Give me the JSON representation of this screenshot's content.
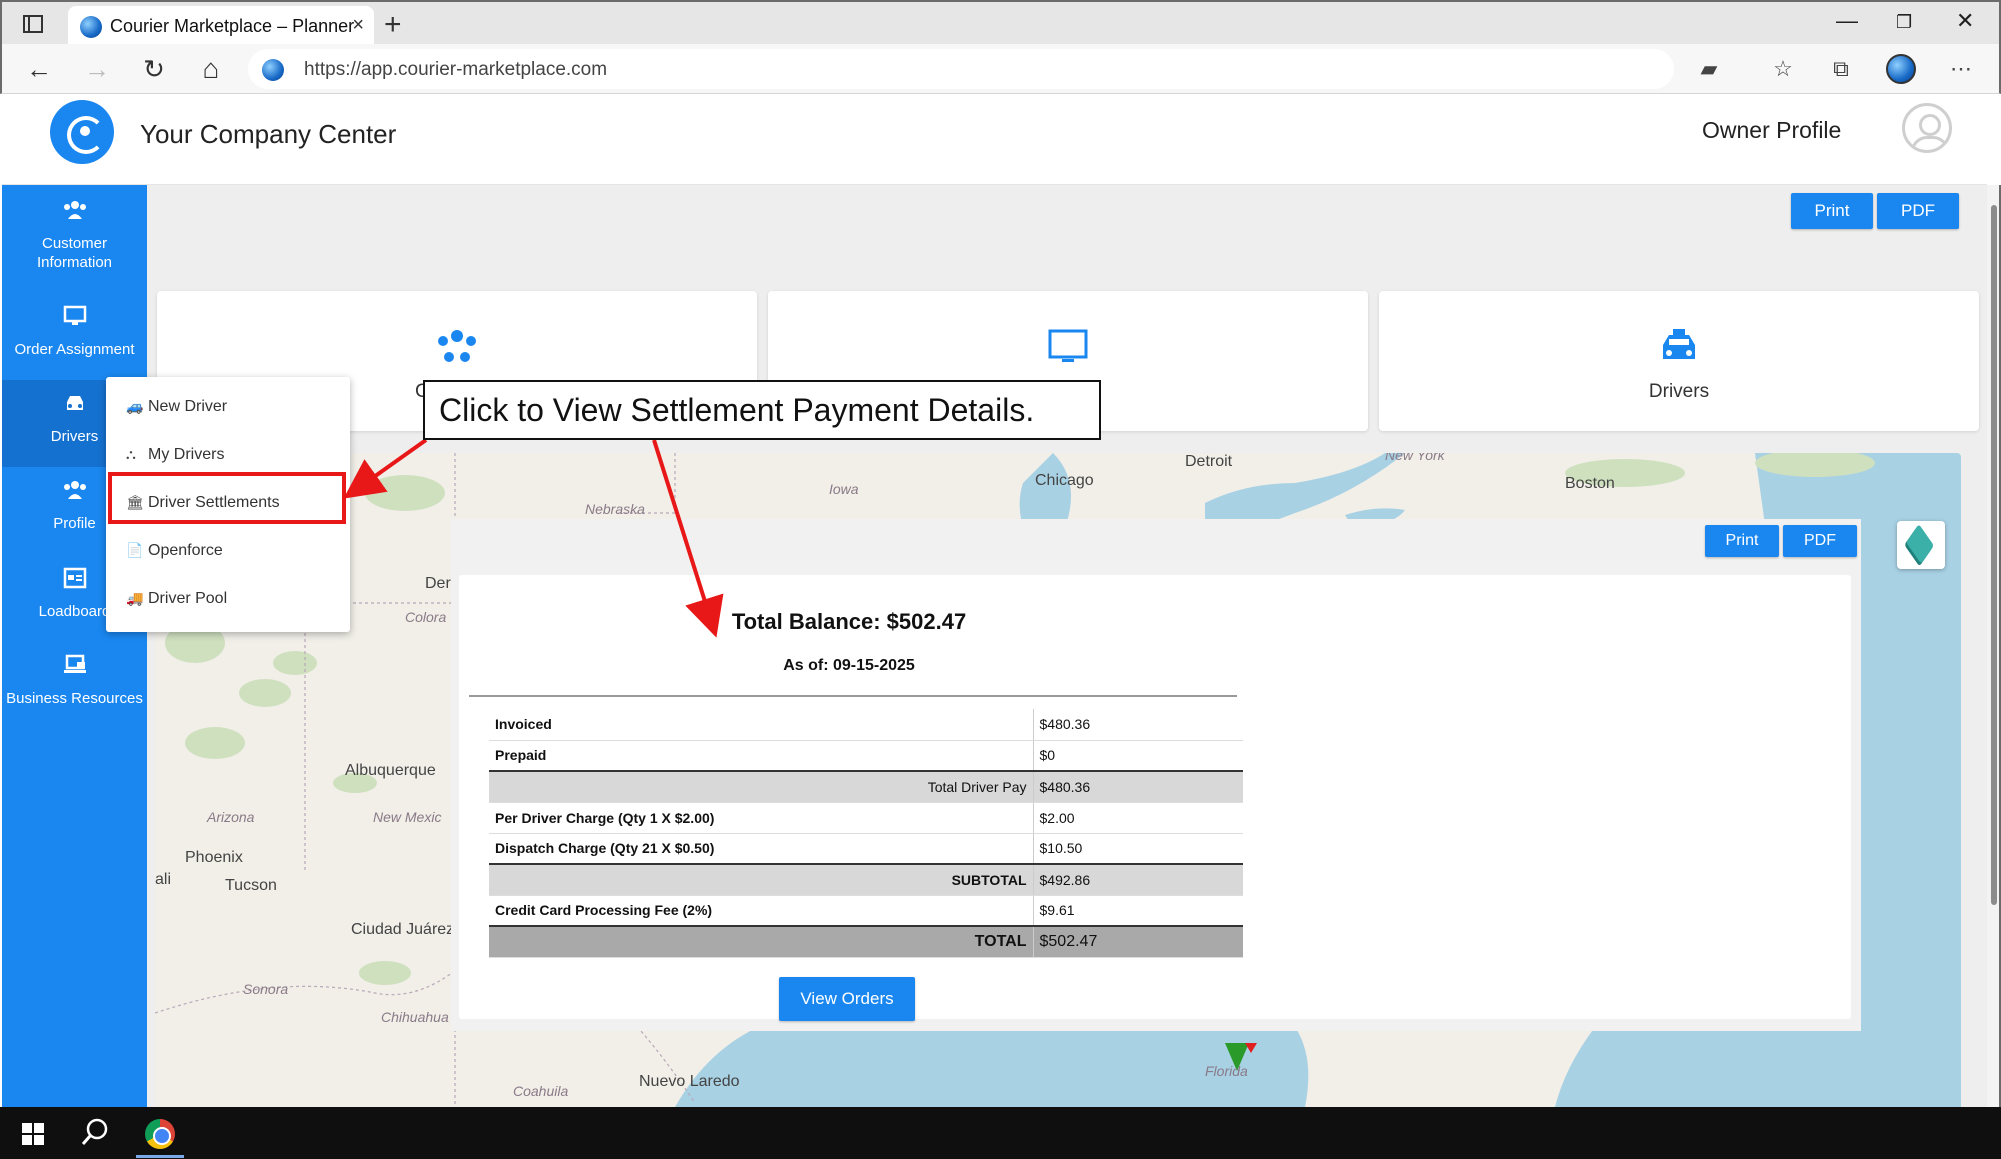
{
  "browser": {
    "tab_title": "Courier Marketplace – Planner",
    "tab_close": "×",
    "new_tab": "+",
    "url": "https://app.courier-marketplace.com",
    "window_controls": {
      "minimize": "—",
      "restore": "❐",
      "close": "✕"
    },
    "nav": {
      "back": "←",
      "forward": "→",
      "reload": "↻",
      "home": "⌂"
    },
    "toolbar_icons": [
      "extension-icon",
      "favorites-icon",
      "collections-icon",
      "profile-icon",
      "more-icon"
    ]
  },
  "header": {
    "title": "Your Company Center",
    "owner_profile": "Owner Profile"
  },
  "sidebar": {
    "items": [
      {
        "label_line1": "Customer",
        "label_line2": "Information",
        "icon": "users-icon"
      },
      {
        "label": "Order Assignment",
        "icon": "monitor-icon"
      },
      {
        "label": "Drivers",
        "icon": "car-icon"
      },
      {
        "label": "Profile",
        "icon": "users-icon"
      },
      {
        "label": "Loadboard",
        "icon": "board-icon"
      },
      {
        "label": "Business Resources",
        "icon": "laptop-lock-icon"
      }
    ]
  },
  "drivers_menu": {
    "items": [
      {
        "label": "New Driver",
        "icon": "car-icon"
      },
      {
        "label": "My Drivers",
        "icon": "group-icon"
      },
      {
        "label": "Driver Settlements",
        "icon": "bank-icon"
      },
      {
        "label": "Openforce",
        "icon": "document-icon"
      },
      {
        "label": "Driver Pool",
        "icon": "truck-icon"
      }
    ]
  },
  "top_buttons": {
    "print": "Print",
    "pdf": "PDF"
  },
  "cards": [
    {
      "label": "C",
      "icon": "users-icon"
    },
    {
      "label": "",
      "icon": "monitor-icon"
    },
    {
      "label": "Drivers",
      "icon": "taxi-icon"
    }
  ],
  "map": {
    "labels": {
      "detroit": "Detroit",
      "chicago": "Chicago",
      "boston": "Boston",
      "new_york": "New York",
      "iowa": "Iowa",
      "nebraska": "Nebraska",
      "denver": "Der",
      "colorado": "Colora",
      "albuquerque": "Albuquerque",
      "arizona": "Arizona",
      "new_mexico": "New Mexic",
      "phoenix": "Phoenix",
      "tucson": "Tucson",
      "cali": "ali",
      "ciudad_juarez": "Ciudad Juárez",
      "sonora": "Sonora",
      "chihuahua": "Chihuahua",
      "coahuila": "Coahuila",
      "nuevo_laredo": "Nuevo Laredo",
      "florida": "Florida"
    }
  },
  "settlement": {
    "print": "Print",
    "pdf": "PDF",
    "title": "Total Balance: $502.47",
    "as_of": "As of: 09-15-2025",
    "rows": [
      {
        "label": "Invoiced",
        "value": "$480.36"
      },
      {
        "label": "Prepaid",
        "value": "$0"
      },
      {
        "label": "Total Driver Pay",
        "value": "$480.36"
      },
      {
        "label": "Per Driver Charge (Qty 1 X $2.00)",
        "value": "$2.00"
      },
      {
        "label": "Dispatch Charge (Qty 21 X $0.50)",
        "value": "$10.50"
      },
      {
        "label": "SUBTOTAL",
        "value": "$492.86"
      },
      {
        "label": "Credit Card Processing Fee (2%)",
        "value": "$9.61"
      },
      {
        "label": "TOTAL",
        "value": "$502.47"
      }
    ],
    "view_orders": "View Orders"
  },
  "annotation": {
    "callout": "Click to View Settlement Payment Details.",
    "color": "#e81818"
  },
  "colors": {
    "accent": "#1a87f0",
    "highlight": "#e81818"
  }
}
